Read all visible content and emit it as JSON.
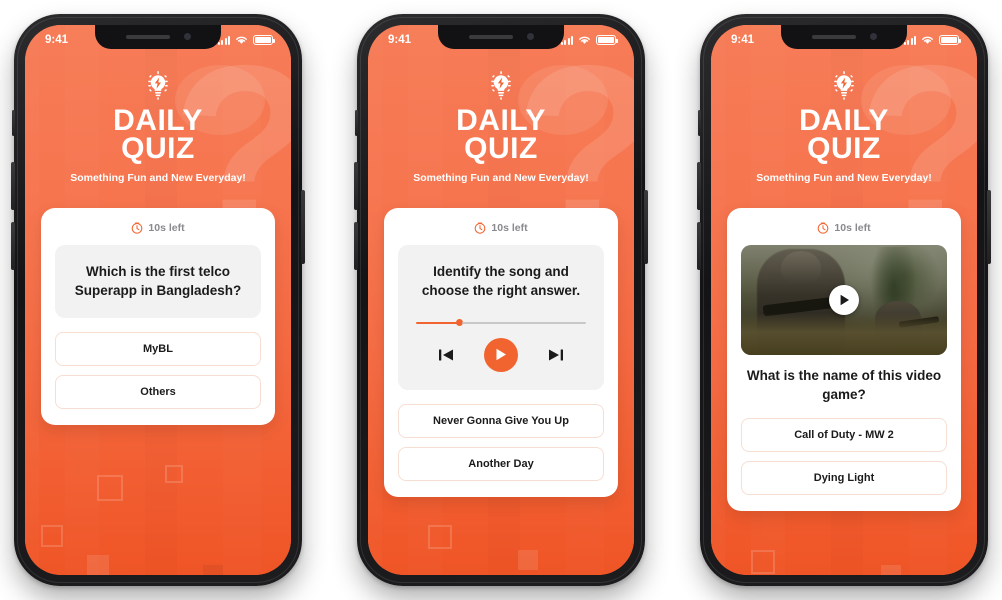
{
  "status_bar": {
    "time": "9:41",
    "signal_icon": "cellular-signal-icon",
    "wifi_icon": "wifi-icon",
    "battery_icon": "battery-icon"
  },
  "header": {
    "logo_icon": "lightbulb-idea-icon",
    "title_line1": "DAILY",
    "title_line2": "QUIZ",
    "tagline": "Something Fun and New Everyday!",
    "watermark": "?"
  },
  "timer": {
    "icon": "clock-icon",
    "label": "10s left"
  },
  "theme": {
    "accent": "#F2642F",
    "bg_top": "#F67C57",
    "bg_bottom": "#EF5526",
    "card_bg": "#FFFFFF",
    "question_box_bg": "#F2F2F2",
    "answer_border": "#F7DED3",
    "timer_text": "#8A8A8E"
  },
  "screens": [
    {
      "type": "text-question",
      "question": "Which is the first telco Superapp in Bangladesh?",
      "answers": [
        "MyBL",
        "Others"
      ]
    },
    {
      "type": "audio-question",
      "question": "Identify the song and choose the right answer.",
      "player": {
        "progress_percent": 25,
        "prev_icon": "skip-previous-icon",
        "play_icon": "play-icon",
        "next_icon": "skip-next-icon"
      },
      "answers": [
        "Never Gonna Give You Up",
        "Another Day"
      ]
    },
    {
      "type": "video-question",
      "video": {
        "play_icon": "play-icon",
        "alt": "military shooter game scene"
      },
      "question": "What is the name of this video game?",
      "answers": [
        "Call of Duty - MW 2",
        "Dying Light"
      ]
    }
  ]
}
